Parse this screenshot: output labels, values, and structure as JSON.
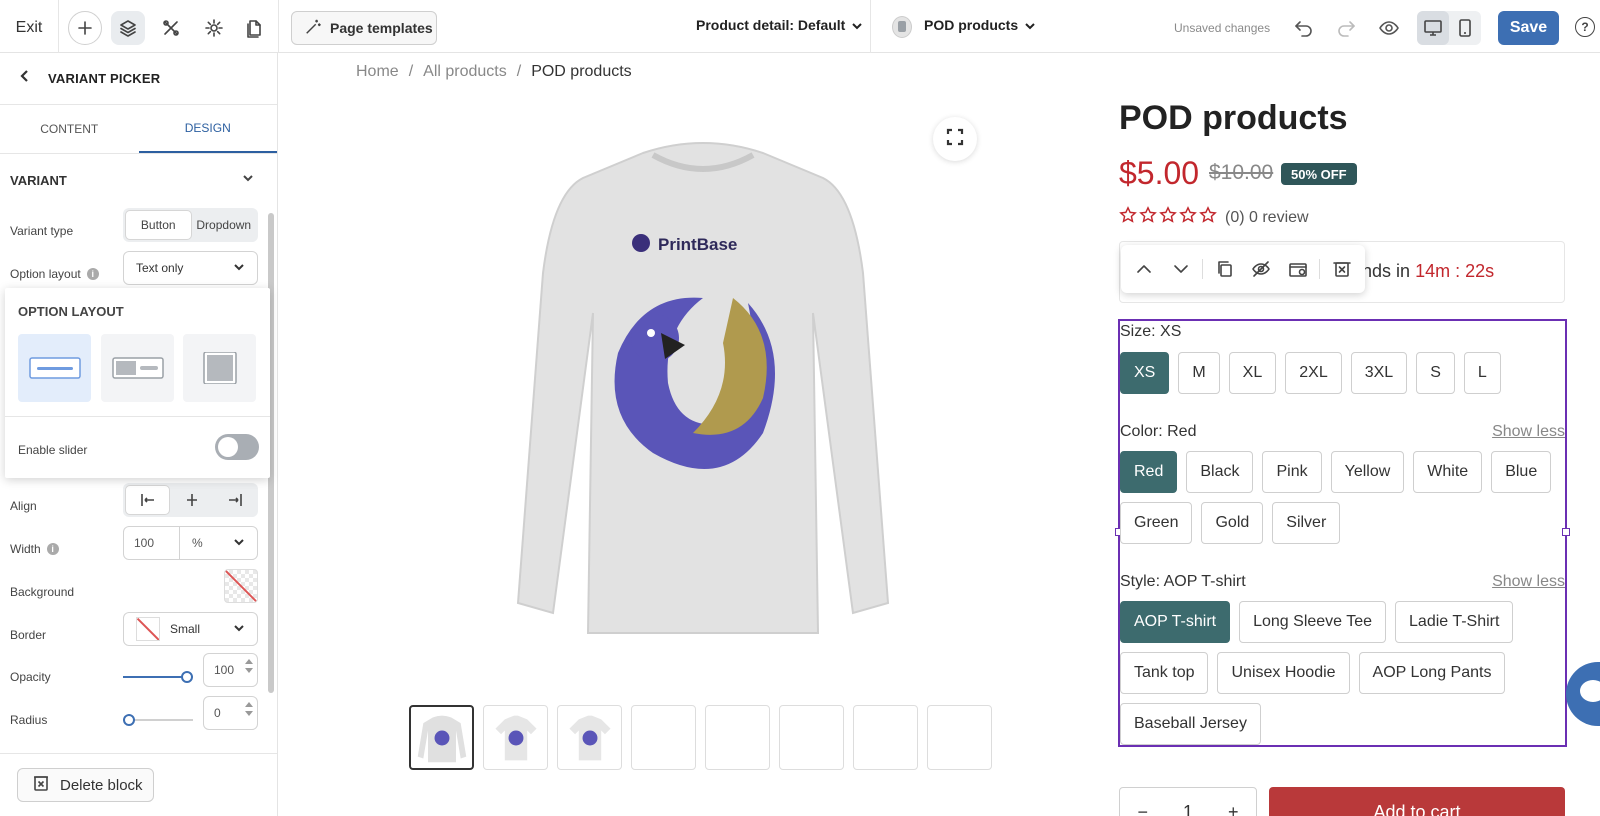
{
  "topbar": {
    "exit_label": "Exit",
    "page_templates_label": "Page templates",
    "page_selector_label": "Product detail: Default",
    "product_selector_label": "POD products",
    "unsaved_label": "Unsaved changes",
    "save_label": "Save",
    "help_label": "?"
  },
  "left_panel": {
    "title": "VARIANT PICKER",
    "tabs": [
      {
        "label": "CONTENT"
      },
      {
        "label": "DESIGN"
      }
    ],
    "section_title": "VARIANT",
    "variant_type": {
      "label": "Variant type",
      "options": [
        "Button",
        "Dropdown"
      ],
      "selected": "Button"
    },
    "option_layout": {
      "label": "Option layout",
      "value": "Text only"
    },
    "popover": {
      "title": "OPTION LAYOUT",
      "enable_slider_label": "Enable slider",
      "enable_slider_on": false
    },
    "align": {
      "label": "Align"
    },
    "width": {
      "label": "Width",
      "value": "100",
      "unit": "%"
    },
    "background": {
      "label": "Background"
    },
    "border": {
      "label": "Border",
      "value": "Small"
    },
    "opacity": {
      "label": "Opacity",
      "value": "100"
    },
    "radius": {
      "label": "Radius",
      "value": "0"
    },
    "delete_label": "Delete block"
  },
  "canvas": {
    "breadcrumb": [
      "Home",
      "All products",
      "POD products"
    ],
    "brand_on_shirt": "PrintBase",
    "product": {
      "title": "POD products",
      "price": "$5.00",
      "compare_price": "$10.00",
      "discount_badge": "50% OFF",
      "rating_text": "(0) 0 review",
      "sale_text_prefix": "e ends in ",
      "sale_timer": "14m : 22s"
    },
    "variants": {
      "size": {
        "label": "Size: XS",
        "options": [
          "XS",
          "M",
          "XL",
          "2XL",
          "3XL",
          "S",
          "L"
        ],
        "selected": "XS"
      },
      "color": {
        "label": "Color: Red",
        "show_less": "Show less",
        "options": [
          "Red",
          "Black",
          "Pink",
          "Yellow",
          "White",
          "Blue",
          "Green",
          "Gold",
          "Silver"
        ],
        "selected": "Red"
      },
      "style": {
        "label": "Style: AOP T-shirt",
        "show_less": "Show less",
        "options": [
          "AOP T-shirt",
          "Long Sleeve Tee",
          "Ladie T-Shirt",
          "Tank top",
          "Unisex Hoodie",
          "AOP Long Pants",
          "Baseball Jersey"
        ],
        "selected": "AOP T-shirt"
      }
    },
    "quantity": {
      "minus": "−",
      "value": "1",
      "plus": "+"
    },
    "add_to_cart_label": "Add to cart"
  },
  "colors": {
    "accent": "#3d6fb3",
    "selected_chip": "#3d6b6e",
    "price_red": "#c2272d",
    "selection_outline": "#6b2fb3"
  }
}
